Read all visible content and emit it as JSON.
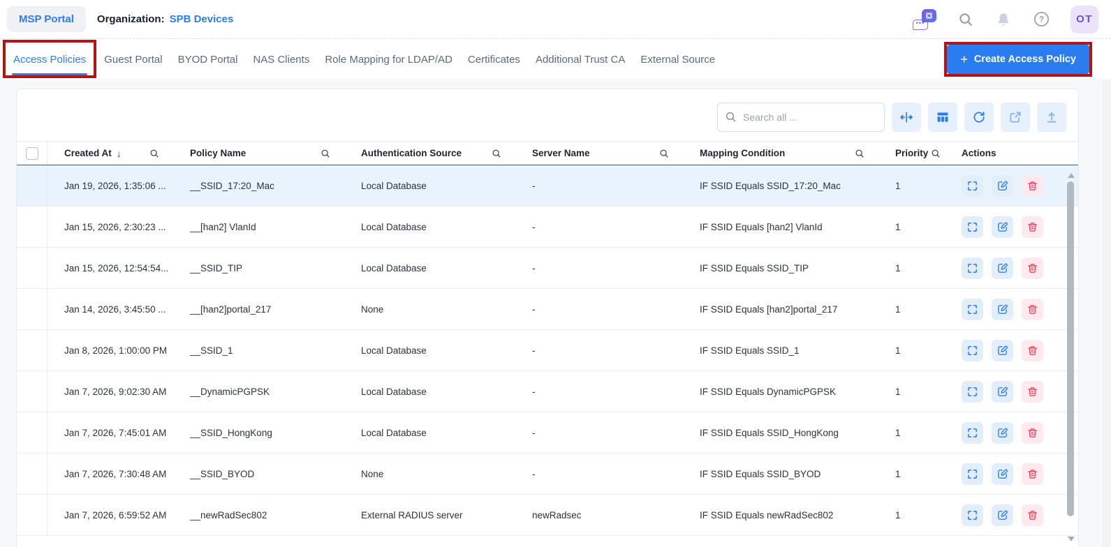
{
  "header": {
    "app_button": "MSP Portal",
    "organization_label": "Organization:",
    "organization_name": "SPB Devices",
    "avatar_initials": "OT",
    "icons": [
      "ai-assistant-icon",
      "search-icon",
      "notifications-bell-icon",
      "help-icon"
    ]
  },
  "tabs": {
    "items": [
      {
        "label": "Access Policies",
        "active": true,
        "annotated": true
      },
      {
        "label": "Guest Portal"
      },
      {
        "label": "BYOD Portal"
      },
      {
        "label": "NAS Clients"
      },
      {
        "label": "Role Mapping for LDAP/AD"
      },
      {
        "label": "Certificates"
      },
      {
        "label": "Additional Trust CA"
      },
      {
        "label": "External Source"
      }
    ]
  },
  "create_button": {
    "plus": "+",
    "label": "Create Access Policy",
    "annotated": true
  },
  "toolbar": {
    "search_placeholder": "Search all ...",
    "buttons": [
      "fit-columns",
      "column-settings",
      "refresh",
      "open-in-new",
      "export"
    ]
  },
  "table": {
    "columns": [
      "Created At",
      "Policy Name",
      "Authentication Source",
      "Server Name",
      "Mapping Condition",
      "Priority",
      "Actions"
    ],
    "sort_column": "Created At",
    "sort_direction": "desc",
    "sort_icon": "↓",
    "row_actions": [
      "expand",
      "edit",
      "delete"
    ],
    "rows": [
      {
        "created_at": "Jan 19, 2026, 1:35:06 ...",
        "policy_name": "__SSID_17:20_Mac",
        "auth_source": "Local Database",
        "server_name": "-",
        "mapping_condition": "IF SSID Equals SSID_17:20_Mac",
        "priority": "1",
        "selected": true
      },
      {
        "created_at": "Jan 15, 2026, 2:30:23 ...",
        "policy_name": "__[han2] VlanId",
        "auth_source": "Local Database",
        "server_name": "-",
        "mapping_condition": "IF SSID Equals [han2] VlanId",
        "priority": "1"
      },
      {
        "created_at": "Jan 15, 2026, 12:54:54...",
        "policy_name": "__SSID_TIP",
        "auth_source": "Local Database",
        "server_name": "-",
        "mapping_condition": "IF SSID Equals SSID_TIP",
        "priority": "1"
      },
      {
        "created_at": "Jan 14, 2026, 3:45:50 ...",
        "policy_name": "__[han2]portal_217",
        "auth_source": "None",
        "server_name": "-",
        "mapping_condition": "IF SSID Equals [han2]portal_217",
        "priority": "1"
      },
      {
        "created_at": "Jan 8, 2026, 1:00:00 PM",
        "policy_name": "__SSID_1",
        "auth_source": "Local Database",
        "server_name": "-",
        "mapping_condition": "IF SSID Equals SSID_1",
        "priority": "1"
      },
      {
        "created_at": "Jan 7, 2026, 9:02:30 AM",
        "policy_name": "__DynamicPGPSK",
        "auth_source": "Local Database",
        "server_name": "-",
        "mapping_condition": "IF SSID Equals DynamicPGPSK",
        "priority": "1"
      },
      {
        "created_at": "Jan 7, 2026, 7:45:01 AM",
        "policy_name": "__SSID_HongKong",
        "auth_source": "Local Database",
        "server_name": "-",
        "mapping_condition": "IF SSID Equals SSID_HongKong",
        "priority": "1"
      },
      {
        "created_at": "Jan 7, 2026, 7:30:48 AM",
        "policy_name": "__SSID_BYOD",
        "auth_source": "None",
        "server_name": "-",
        "mapping_condition": "IF SSID Equals SSID_BYOD",
        "priority": "1"
      },
      {
        "created_at": "Jan 7, 2026, 6:59:52 AM",
        "policy_name": "__newRadSec802",
        "auth_source": "External RADIUS server",
        "server_name": "newRadsec",
        "mapping_condition": "IF SSID Equals newRadSec802",
        "priority": "1"
      }
    ]
  },
  "colors": {
    "accent_blue": "#2b7cf0",
    "annotation_red": "#b31414",
    "delete_red": "#e8455f",
    "selected_row_bg": "#e9f3fd",
    "page_bg": "#f7f8fa",
    "icon_button_bg": "#e7f0fd",
    "delete_button_bg": "#fde9ee"
  }
}
